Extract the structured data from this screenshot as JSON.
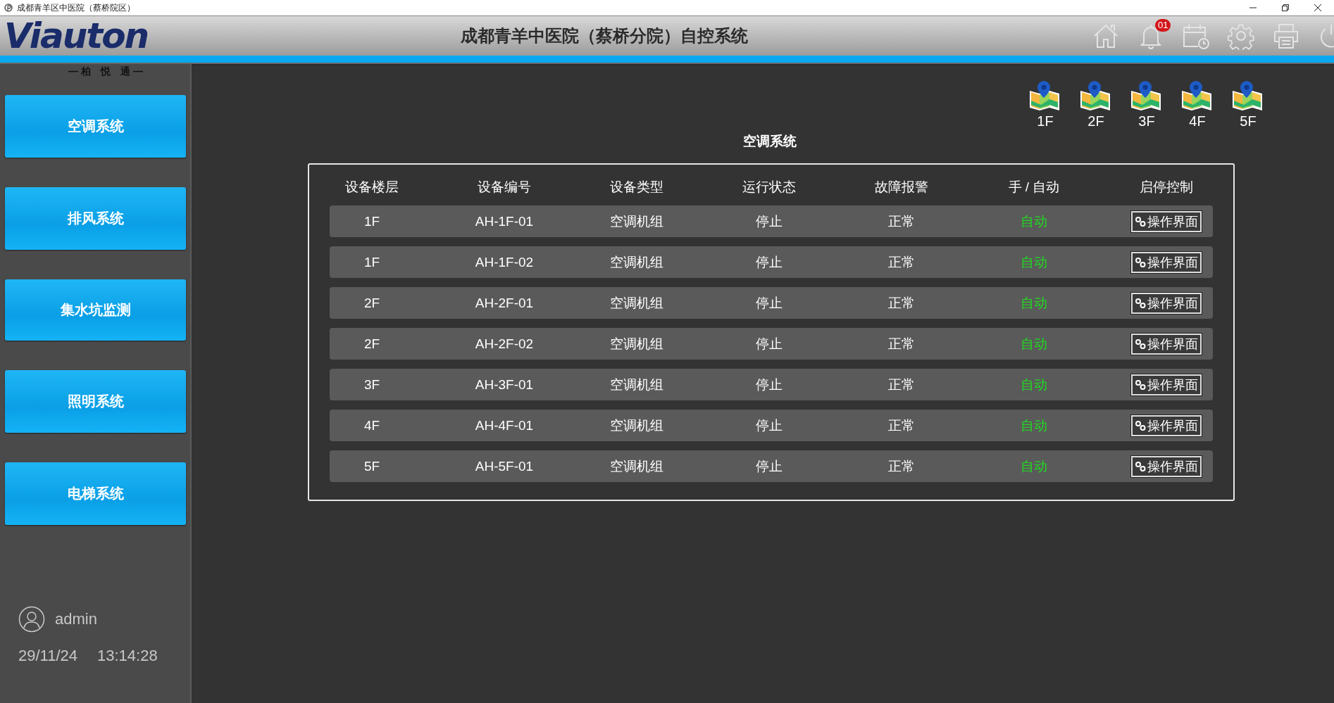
{
  "window": {
    "title": "成都青羊区中医院（蔡桥院区）"
  },
  "header": {
    "logo": "Viauton",
    "logo_subtitle": "— 柏　悦　通 —",
    "title": "成都青羊中医院（蔡桥分院）自控系统",
    "notification_count": "01"
  },
  "sidebar": {
    "items": [
      {
        "label": "空调系统"
      },
      {
        "label": "排风系统"
      },
      {
        "label": "集水坑监测"
      },
      {
        "label": "照明系统"
      },
      {
        "label": "电梯系统"
      }
    ],
    "user": "admin",
    "date": "29/11/24",
    "time": "13:14:28"
  },
  "floors": [
    "1F",
    "2F",
    "3F",
    "4F",
    "5F"
  ],
  "panel": {
    "title": "空调系统",
    "table": {
      "columns": [
        "设备楼层",
        "设备编号",
        "设备类型",
        "运行状态",
        "故障报警",
        "手 / 自动",
        "启停控制"
      ],
      "rows": [
        {
          "floor": "1F",
          "id": "AH-1F-01",
          "type": "空调机组",
          "run": "停止",
          "alarm": "正常",
          "mode": "自动",
          "action": "操作界面"
        },
        {
          "floor": "1F",
          "id": "AH-1F-02",
          "type": "空调机组",
          "run": "停止",
          "alarm": "正常",
          "mode": "自动",
          "action": "操作界面"
        },
        {
          "floor": "2F",
          "id": "AH-2F-01",
          "type": "空调机组",
          "run": "停止",
          "alarm": "正常",
          "mode": "自动",
          "action": "操作界面"
        },
        {
          "floor": "2F",
          "id": "AH-2F-02",
          "type": "空调机组",
          "run": "停止",
          "alarm": "正常",
          "mode": "自动",
          "action": "操作界面"
        },
        {
          "floor": "3F",
          "id": "AH-3F-01",
          "type": "空调机组",
          "run": "停止",
          "alarm": "正常",
          "mode": "自动",
          "action": "操作界面"
        },
        {
          "floor": "4F",
          "id": "AH-4F-01",
          "type": "空调机组",
          "run": "停止",
          "alarm": "正常",
          "mode": "自动",
          "action": "操作界面"
        },
        {
          "floor": "5F",
          "id": "AH-5F-01",
          "type": "空调机组",
          "run": "停止",
          "alarm": "正常",
          "mode": "自动",
          "action": "操作界面"
        }
      ]
    }
  }
}
